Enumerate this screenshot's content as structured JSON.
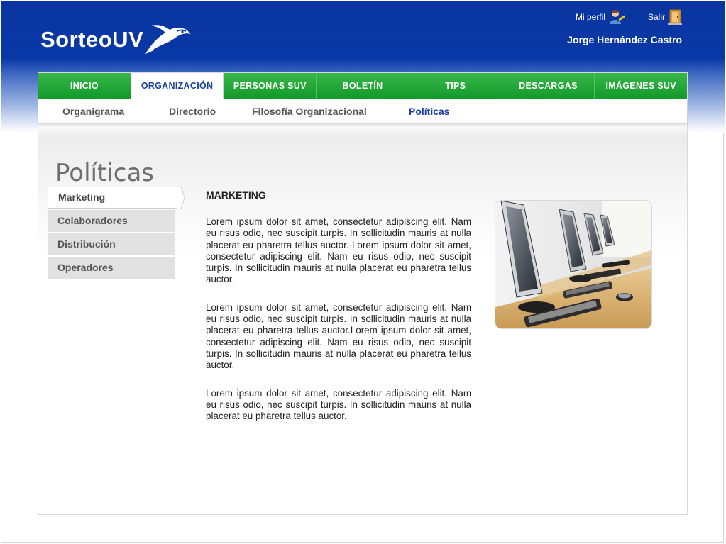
{
  "brand": {
    "logo_text": "SorteoUV"
  },
  "user": {
    "profile_label": "Mi perfil",
    "logout_label": "Salir",
    "name": "Jorge Hernández Castro"
  },
  "main_nav": {
    "tabs": [
      {
        "label": "INICIO",
        "active": false
      },
      {
        "label": "ORGANIZACIÓN",
        "active": true
      },
      {
        "label": "PERSONAS SUV",
        "active": false
      },
      {
        "label": "BOLETÍN",
        "active": false
      },
      {
        "label": "TIPS",
        "active": false
      },
      {
        "label": "DESCARGAS",
        "active": false
      },
      {
        "label": "IMÁGENES SUV",
        "active": false
      }
    ]
  },
  "sub_nav": {
    "items": [
      {
        "label": "Organigrama",
        "active": false
      },
      {
        "label": "Directorio",
        "active": false
      },
      {
        "label": "Filosofía Organizacional",
        "active": false
      },
      {
        "label": "Políticas",
        "active": true
      }
    ]
  },
  "page": {
    "title": "Políticas"
  },
  "side_menu": {
    "items": [
      {
        "label": "Marketing",
        "active": true
      },
      {
        "label": "Colaboradores",
        "active": false
      },
      {
        "label": "Distribución",
        "active": false
      },
      {
        "label": "Operadores",
        "active": false
      }
    ]
  },
  "article": {
    "heading": "MARKETING",
    "paragraphs": [
      "Lorem ipsum dolor sit amet, consectetur adipiscing elit. Nam eu risus odio, nec suscipit turpis. In sollicitudin mauris at nulla placerat eu pharetra tellus auctor. Lorem ipsum dolor sit amet, consectetur adipiscing elit. Nam eu risus odio, nec suscipit turpis. In sollicitudin mauris at nulla placerat eu pharetra tellus auctor.",
      "Lorem ipsum dolor sit amet, consectetur adipiscing elit. Nam eu risus odio, nec suscipit turpis. In sollicitudin mauris at nulla placerat eu pharetra tellus auctor.Lorem ipsum dolor sit amet, consectetur adipiscing elit. Nam eu risus odio, nec suscipit turpis. In sollicitudin mauris at nulla placerat eu pharetra tellus auctor.",
      "Lorem ipsum dolor sit amet, consectetur adipiscing elit. Nam eu risus odio, nec suscipit turpis. In sollicitudin mauris at nulla placerat eu pharetra tellus auctor."
    ]
  },
  "icons": {
    "profile": "user-edit-icon",
    "logout": "door-exit-icon",
    "photo": "computer-lab-photo"
  },
  "colors": {
    "header_blue": "#0838a6",
    "nav_green": "#1ea634",
    "active_text_blue": "#1b3fa0"
  }
}
